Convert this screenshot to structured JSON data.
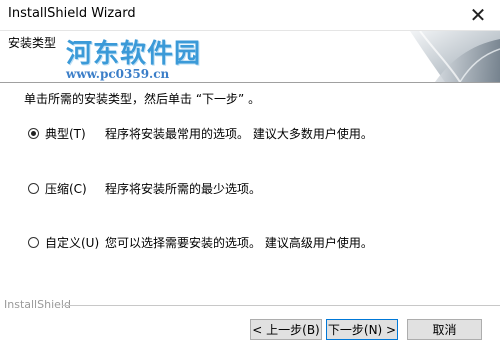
{
  "window": {
    "title": "InstallShield Wizard",
    "close_glyph": "✕"
  },
  "header": {
    "section_title": "安装类型",
    "watermark_title": "河东软件园",
    "watermark_url": "www.pc0359.cn"
  },
  "body": {
    "instruction": "单击所需的安装类型，然后单击 “下一步” 。",
    "options": [
      {
        "label": "典型(T)",
        "description": "程序将安装最常用的选项。  建议大多数用户使用。",
        "selected": true
      },
      {
        "label": "压缩(C)",
        "description": "程序将安装所需的最少选项。",
        "selected": false
      },
      {
        "label": "自定义(U)",
        "description": "您可以选择需要安装的选项。  建议高级用户使用。",
        "selected": false
      }
    ]
  },
  "footer": {
    "brand": "InstallShield",
    "back_label": "< 上一步(B)",
    "next_label": "下一步(N) >",
    "cancel_label": "取消"
  },
  "colors": {
    "watermark": "#3b9ad8",
    "default_button_border": "#0078d7"
  }
}
